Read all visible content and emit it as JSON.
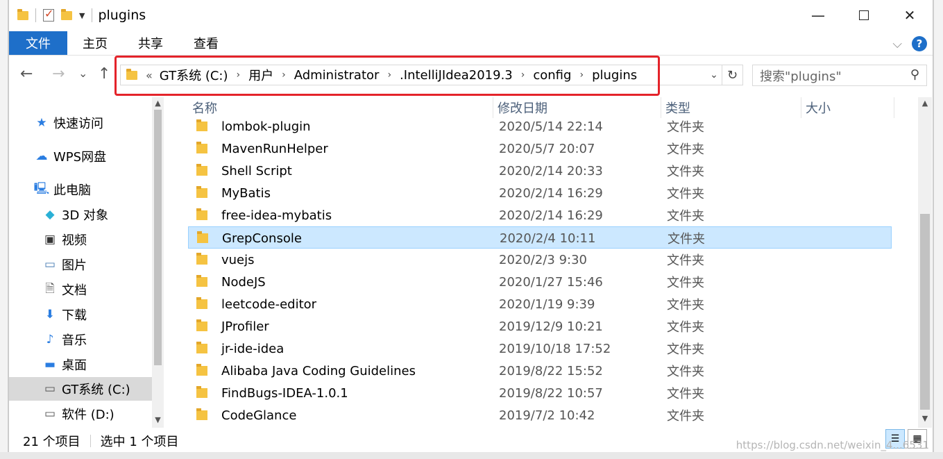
{
  "window": {
    "title": "plugins",
    "minimize": "—",
    "close": "✕"
  },
  "ribbon": {
    "tabs": [
      "文件",
      "主页",
      "共享",
      "查看"
    ]
  },
  "nav": {
    "back": "←",
    "forward": "→",
    "recent": "⌄",
    "up": "↑"
  },
  "address": {
    "overflow": "«",
    "crumbs": [
      "GT系统 (C:)",
      "用户",
      "Administrator",
      ".IntelliJIdea2019.3",
      "config",
      "plugins"
    ],
    "separator": "›"
  },
  "search": {
    "placeholder": "搜索\"plugins\""
  },
  "sidebar": {
    "items": [
      {
        "label": "快速访问",
        "icon": "star-icon"
      },
      {
        "label": "WPS网盘",
        "icon": "cloud-icon"
      },
      {
        "label": "此电脑",
        "icon": "computer-icon"
      },
      {
        "label": "3D 对象",
        "icon": "cube-icon"
      },
      {
        "label": "视频",
        "icon": "video-icon"
      },
      {
        "label": "图片",
        "icon": "picture-icon"
      },
      {
        "label": "文档",
        "icon": "document-icon"
      },
      {
        "label": "下载",
        "icon": "download-icon"
      },
      {
        "label": "音乐",
        "icon": "music-icon"
      },
      {
        "label": "桌面",
        "icon": "desktop-icon"
      },
      {
        "label": "GT系统 (C:)",
        "icon": "drive-c-icon",
        "selected": true
      },
      {
        "label": "软件 (D:)",
        "icon": "drive-d-icon"
      }
    ]
  },
  "columns": [
    "名称",
    "修改日期",
    "类型",
    "大小"
  ],
  "files": [
    {
      "name": "lombok-plugin",
      "date": "2020/5/14 22:14",
      "type": "文件夹"
    },
    {
      "name": "MavenRunHelper",
      "date": "2020/5/7 20:07",
      "type": "文件夹"
    },
    {
      "name": "Shell Script",
      "date": "2020/2/14 20:33",
      "type": "文件夹"
    },
    {
      "name": "MyBatis",
      "date": "2020/2/14 16:29",
      "type": "文件夹"
    },
    {
      "name": "free-idea-mybatis",
      "date": "2020/2/14 16:29",
      "type": "文件夹"
    },
    {
      "name": "GrepConsole",
      "date": "2020/2/4 10:11",
      "type": "文件夹",
      "selected": true
    },
    {
      "name": "vuejs",
      "date": "2020/2/3 9:30",
      "type": "文件夹"
    },
    {
      "name": "NodeJS",
      "date": "2020/1/27 15:46",
      "type": "文件夹"
    },
    {
      "name": "leetcode-editor",
      "date": "2020/1/19 9:39",
      "type": "文件夹"
    },
    {
      "name": "JProfiler",
      "date": "2019/12/9 10:21",
      "type": "文件夹"
    },
    {
      "name": "jr-ide-idea",
      "date": "2019/10/18 17:52",
      "type": "文件夹"
    },
    {
      "name": "Alibaba Java Coding Guidelines",
      "date": "2019/8/22 15:52",
      "type": "文件夹"
    },
    {
      "name": "FindBugs-IDEA-1.0.1",
      "date": "2019/8/22 10:57",
      "type": "文件夹"
    },
    {
      "name": "CodeGlance",
      "date": "2019/7/2 10:42",
      "type": "文件夹"
    }
  ],
  "status": {
    "count": "21 个项目",
    "selection": "选中 1 个项目"
  },
  "watermark": "https://blog.csdn.net/weixin_4...6531",
  "colors": {
    "accent": "#1e6fc9",
    "highlight": "#e4232a",
    "selection": "#cce8ff"
  }
}
